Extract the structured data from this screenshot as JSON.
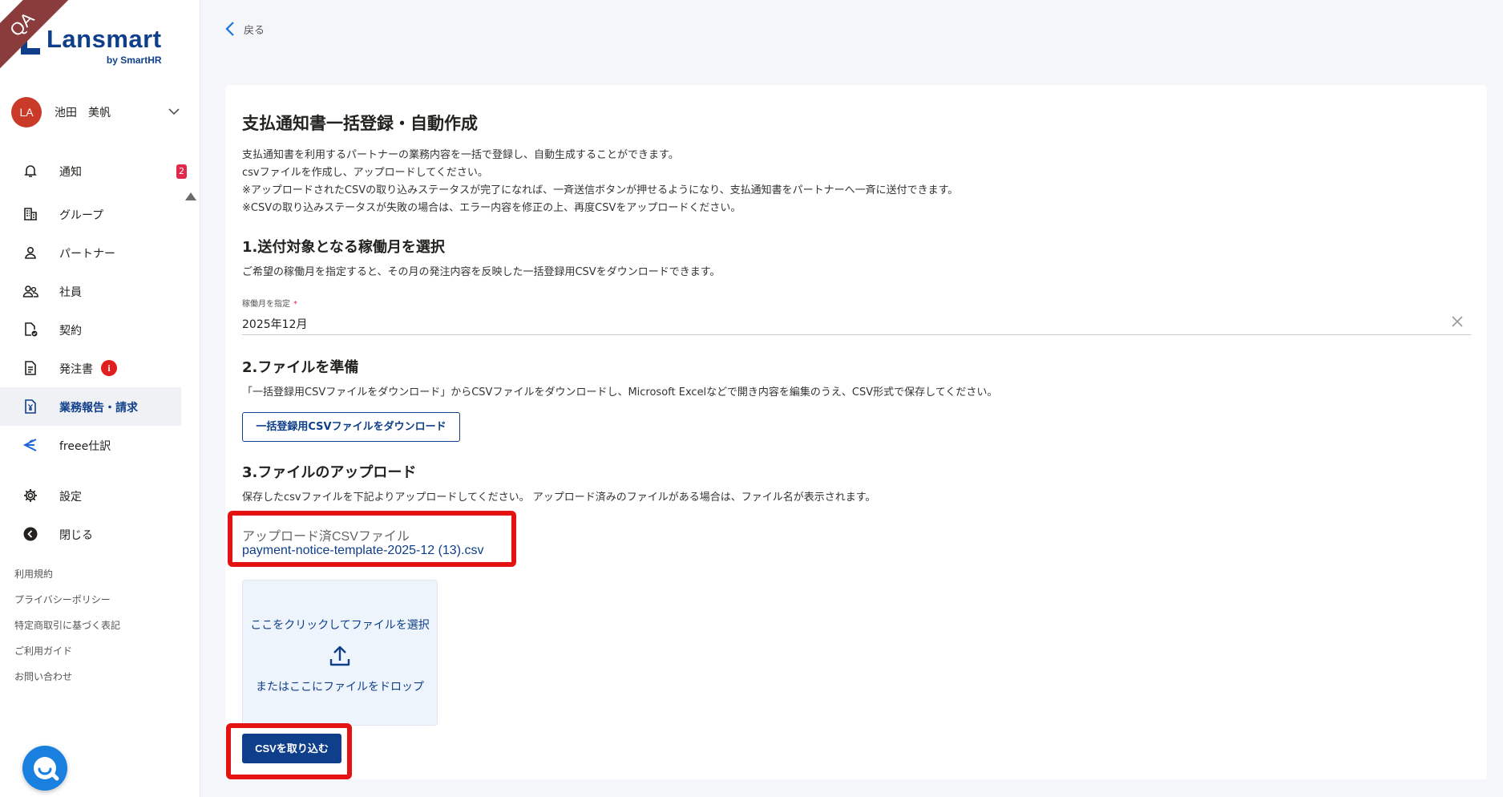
{
  "ribbon": {
    "label": "QA"
  },
  "brand": {
    "name": "Lansmart",
    "sub": "by SmartHR"
  },
  "user": {
    "initials": "LA",
    "name": "池田　美帆"
  },
  "nav": [
    {
      "label": "通知",
      "icon": "bell-icon",
      "badge": "2"
    },
    {
      "label": "グループ",
      "icon": "building-icon"
    },
    {
      "label": "パートナー",
      "icon": "person-icon"
    },
    {
      "label": "社員",
      "icon": "people-icon"
    },
    {
      "label": "契約",
      "icon": "contract-check-icon"
    },
    {
      "label": "発注書",
      "icon": "document-icon",
      "badge": "i"
    },
    {
      "label": "業務報告・請求",
      "icon": "invoice-yen-icon",
      "active": true
    },
    {
      "label": "freee仕訳",
      "icon": "freee-icon"
    },
    {
      "label": "設定",
      "icon": "gear-icon"
    },
    {
      "label": "閉じる",
      "icon": "collapse-left-icon"
    }
  ],
  "footer_links": [
    "利用規約",
    "プライバシーポリシー",
    "特定商取引に基づく表記",
    "ご利用ガイド",
    "お問い合わせ"
  ],
  "back": {
    "label": "戻る"
  },
  "page": {
    "title": "支払通知書一括登録・自動作成",
    "desc": [
      "支払通知書を利用するパートナーの業務内容を一括で登録し、自動生成することができます。",
      "csvファイルを作成し、アップロードしてください。",
      "※アップロードされたCSVの取り込みステータスが完了になれば、一斉送信ボタンが押せるようになり、支払通知書をパートナーへ一斉に送付できます。",
      "※CSVの取り込みステータスが失敗の場合は、エラー内容を修正の上、再度CSVをアップロードください。"
    ],
    "step1": {
      "heading": "1.送付対象となる稼働月を選択",
      "desc": "ご希望の稼働月を指定すると、その月の発注内容を反映した一括登録用CSVをダウンロードできます。",
      "field_label": "稼働月を指定",
      "required_mark": "*",
      "value": "2025年12月"
    },
    "step2": {
      "heading": "2.ファイルを準備",
      "desc": "「一括登録用CSVファイルをダウンロード」からCSVファイルをダウンロードし、Microsoft Excelなどで開き内容を編集のうえ、CSV形式で保存してください。",
      "button": "一括登録用CSVファイルをダウンロード"
    },
    "step3": {
      "heading": "3.ファイルのアップロード",
      "desc": "保存したcsvファイルを下記よりアップロードしてください。 アップロード済みのファイルがある場合は、ファイル名が表示されます。",
      "uploaded_label": "アップロード済CSVファイル",
      "uploaded_file": "payment-notice-template-2025-12 (13).csv",
      "drop_click": "ここをクリックしてファイルを選択",
      "drop_or": "またはここにファイルをドロップ",
      "import_button": "CSVを取り込む"
    }
  },
  "colors": {
    "brand": "#0f3f8a",
    "highlight": "#e41212",
    "badge": "#e0294a"
  }
}
